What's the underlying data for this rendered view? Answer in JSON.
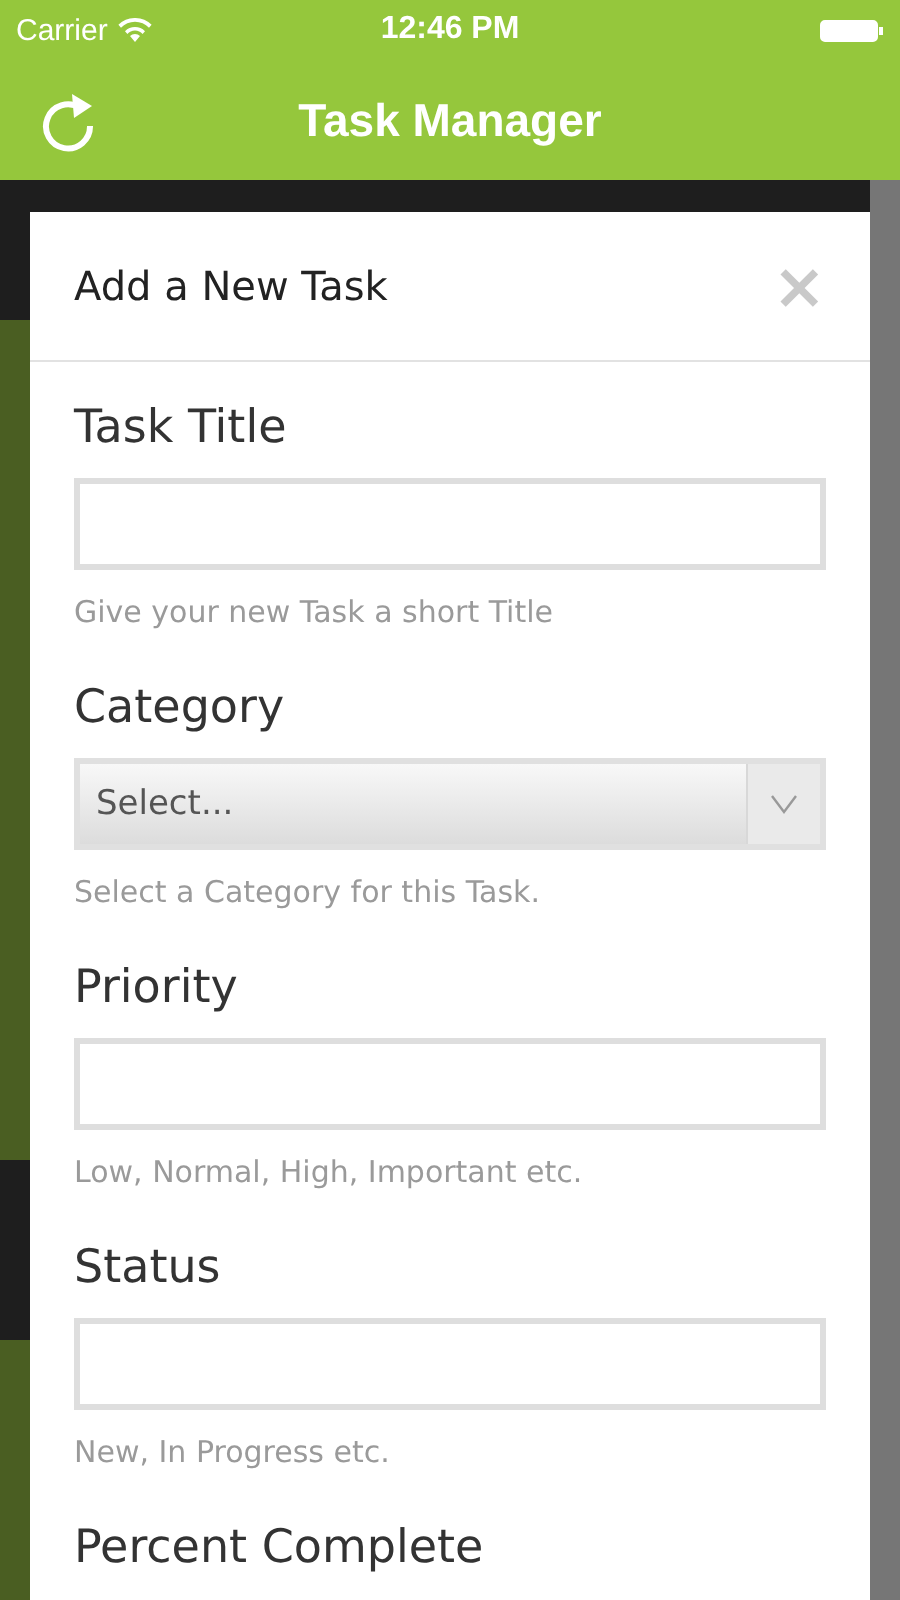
{
  "status_bar": {
    "carrier": "Carrier",
    "time": "12:46 PM"
  },
  "nav_bar": {
    "title": "Task Manager"
  },
  "modal": {
    "title": "Add a New Task",
    "close": "×",
    "fields": [
      {
        "kind": "text",
        "label": "Task Title",
        "hint": "Give your new Task a short Title"
      },
      {
        "kind": "select",
        "label": "Category",
        "value": "Select...",
        "hint": "Select a Category for this Task."
      },
      {
        "kind": "text",
        "label": "Priority",
        "hint": "Low, Normal, High, Important etc."
      },
      {
        "kind": "text",
        "label": "Status",
        "hint": "New, In Progress etc."
      },
      {
        "kind": "label",
        "label": "Percent Complete"
      }
    ]
  }
}
